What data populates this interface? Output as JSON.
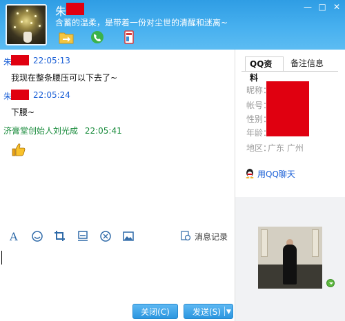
{
  "header": {
    "contact_name": "朱",
    "signature": "含蓄的温柔，是带着一份对尘世的清醒和迷离~",
    "icons": [
      "file-transfer-icon",
      "phone-call-icon",
      "remote-assist-icon"
    ],
    "window_controls": {
      "min": "—",
      "max": "□",
      "close": "✕"
    }
  },
  "messages": [
    {
      "sender": "朱",
      "time": "22:05:13",
      "text": "我现在整条腰压可以下去了~"
    },
    {
      "sender": "朱",
      "time": "22:05:24",
      "text": "下腰~"
    },
    {
      "sender": "济膏堂创始人刘光成",
      "time": "22:05:41",
      "text": ""
    }
  ],
  "toolbar": {
    "icons": [
      "font-icon",
      "emoji-icon",
      "screenshot-icon",
      "shake-icon",
      "magic-icon",
      "image-icon"
    ],
    "history_label": "消息记录"
  },
  "buttons": {
    "close": "关闭(C)",
    "send": "发送(S)"
  },
  "profile": {
    "tabs": [
      "QQ资料",
      "备注信息"
    ],
    "fields": [
      "昵称：",
      "帐号：",
      "性别：",
      "年龄："
    ],
    "region_label": "地区：",
    "region_value": "广东 广州",
    "chat_link": "用QQ聊天"
  },
  "colors": {
    "header": "#47b0ef",
    "button": "#2b96e0",
    "redaction": "#e00010",
    "sender": "#1a5fd6",
    "self_sender": "#178a3a"
  }
}
